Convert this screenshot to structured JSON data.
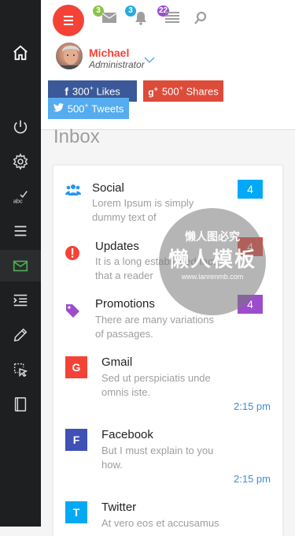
{
  "user": {
    "name": "Michael",
    "role": "Administrator"
  },
  "top_badges": {
    "mail": "3",
    "bell": "3",
    "list": "22"
  },
  "social": {
    "likes": {
      "count": "300",
      "sup": "+",
      "label": "Likes"
    },
    "shares": {
      "count": "500",
      "sup": "+",
      "label": "Shares"
    },
    "tweets": {
      "count": "500",
      "sup": "+",
      "label": "Tweets"
    }
  },
  "inbox": {
    "title": "Inbox",
    "categories": [
      {
        "title": "Social",
        "text1": "Lorem Ipsum is simply",
        "text2": "dummy text of",
        "count": "4",
        "icon": "users-icon",
        "color": "#03a9f4"
      },
      {
        "title": "Updates",
        "text1": "It is a long established fact",
        "text2": "that a reader",
        "count": "4",
        "icon": "alert-icon",
        "color": "#f44336"
      },
      {
        "title": "Promotions",
        "text1": "There are many variations",
        "text2": "of passages.",
        "count": "4",
        "icon": "tag-icon",
        "color": "#9c4dcc"
      }
    ],
    "messages": [
      {
        "letter": "G",
        "title": "Gmail",
        "text1": "Sed ut perspiciatis unde",
        "text2": "omnis iste.",
        "time": "2:15 pm",
        "color": "#f44336"
      },
      {
        "letter": "F",
        "title": "Facebook",
        "text1": "But I must explain to you",
        "text2": "how.",
        "time": "2:15 pm",
        "color": "#3f51b5"
      },
      {
        "letter": "T",
        "title": "Twitter",
        "text1": "At vero eos et accusamus",
        "text2": "",
        "time": "",
        "color": "#03a9f4"
      }
    ]
  },
  "watermark": {
    "line1": "懒人图必究",
    "line2": "懒人模板",
    "line3": "www.lanrenmb.com"
  },
  "colors": {
    "accent": "#f44336",
    "sidebar": "#1e1f20",
    "active": "#4caf50"
  }
}
